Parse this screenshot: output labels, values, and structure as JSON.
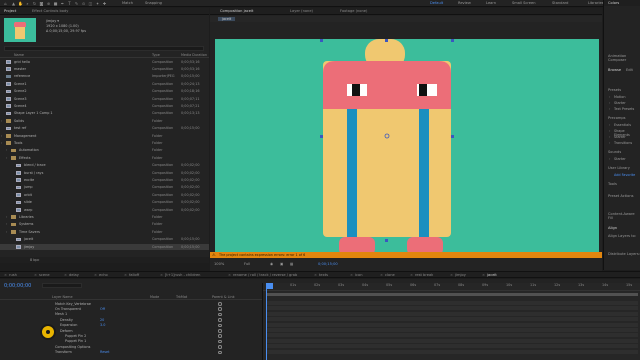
{
  "toolbar": {
    "tools": [
      "home",
      "select",
      "hand",
      "zoom",
      "rotate",
      "camera",
      "pan",
      "mask",
      "pen",
      "type",
      "brush",
      "clone",
      "eraser",
      "roto",
      "puppet"
    ],
    "match_label": "Match",
    "snapping_label": "Snapping",
    "ws": {
      "default": "Default",
      "review": "Review",
      "learn": "Learn",
      "small_screen": "Small Screen",
      "standard": "Standard",
      "libraries": "Libraries"
    },
    "colors": {
      "accent": "#4a8ef0",
      "canvas_bg": "#3cbd9b",
      "warning": "#e2860e"
    }
  },
  "project": {
    "tabs": [
      "Project",
      "Effect Controls body"
    ],
    "selected_name": "jimjoy ▾",
    "info": [
      "1920 x 1080 (1.00)",
      "Δ 0;00;15;00, 29.97 fps"
    ],
    "columns": {
      "name": "Name",
      "type": "Type",
      "duration": "Media Duration"
    },
    "rows": [
      {
        "name": "grid hello",
        "type": "Composition",
        "duration": "0;00;53;16",
        "icon": "comp",
        "indent": 0
      },
      {
        "name": "master",
        "type": "Composition",
        "duration": "0;00;53;16",
        "icon": "comp",
        "indent": 0
      },
      {
        "name": "reference",
        "type": "ImporterJPEG",
        "duration": "0;00;15;00",
        "icon": "img",
        "indent": 0
      },
      {
        "name": "Scene1",
        "type": "Composition",
        "duration": "0;00;24;13",
        "icon": "comp",
        "indent": 0
      },
      {
        "name": "Scene2",
        "type": "Composition",
        "duration": "0;00;18;16",
        "icon": "comp",
        "indent": 0
      },
      {
        "name": "Scene3",
        "type": "Composition",
        "duration": "0;00;07;11",
        "icon": "comp",
        "indent": 0
      },
      {
        "name": "Scene4",
        "type": "Composition",
        "duration": "0;00;07;21",
        "icon": "comp",
        "indent": 0
      },
      {
        "name": "Shape Layer 1 Comp 1",
        "type": "Composition",
        "duration": "0;00;13;13",
        "icon": "comp",
        "indent": 0
      },
      {
        "name": "Solids",
        "type": "Folder",
        "duration": "",
        "icon": "folder",
        "indent": 0
      },
      {
        "name": "test ref",
        "type": "Composition",
        "duration": "0;00;15;00",
        "icon": "comp",
        "indent": 0
      },
      {
        "name": "Management",
        "type": "Folder",
        "duration": "",
        "icon": "folder",
        "indent": 0
      },
      {
        "name": "Tools",
        "type": "Folder",
        "duration": "",
        "icon": "folder",
        "indent": 0
      },
      {
        "name": "Automation",
        "type": "Folder",
        "duration": "",
        "icon": "folder",
        "indent": 1
      },
      {
        "name": "Effects",
        "type": "Folder",
        "duration": "",
        "icon": "folder",
        "indent": 1
      },
      {
        "name": "blend / trace",
        "type": "Composition",
        "duration": "0;00;02;00",
        "icon": "comp",
        "indent": 2
      },
      {
        "name": "burst / rays",
        "type": "Composition",
        "duration": "0;00;02;00",
        "icon": "comp",
        "indent": 2
      },
      {
        "name": "excite",
        "type": "Composition",
        "duration": "0;00;02;00",
        "icon": "comp",
        "indent": 2
      },
      {
        "name": "jump",
        "type": "Composition",
        "duration": "0;00;02;00",
        "icon": "comp",
        "indent": 2
      },
      {
        "name": "orbit",
        "type": "Composition",
        "duration": "0;00;02;00",
        "icon": "comp",
        "indent": 2
      },
      {
        "name": "slide",
        "type": "Composition",
        "duration": "0;00;02;00",
        "icon": "comp",
        "indent": 2
      },
      {
        "name": "warp",
        "type": "Composition",
        "duration": "0;00;02;00",
        "icon": "comp",
        "indent": 2
      },
      {
        "name": "Libraries",
        "type": "Folder",
        "duration": "",
        "icon": "folder",
        "indent": 1
      },
      {
        "name": "Systems",
        "type": "Folder",
        "duration": "",
        "icon": "folder",
        "indent": 1
      },
      {
        "name": "Time Savers",
        "type": "Folder",
        "duration": "",
        "icon": "folder",
        "indent": 1
      },
      {
        "name": "jaceit",
        "type": "Composition",
        "duration": "0;00;15;00",
        "icon": "comp",
        "indent": 2
      },
      {
        "name": "jimjoy",
        "type": "Composition",
        "duration": "0;00;15;00",
        "icon": "comp",
        "indent": 2,
        "selected": true
      }
    ],
    "footer_depth": "8 bpc"
  },
  "viewer": {
    "tabs": [
      "Composition jaceit",
      "Layer (none)",
      "Footage (none)"
    ],
    "breadcrumb": "jaceit",
    "warning": "The project contains expression errors: error 1 of 6",
    "zoom": "100%",
    "quality": "Full",
    "timecode": "0;00;15;00"
  },
  "right_panel": {
    "header": "Colors",
    "items_top": [
      "Animation Composer"
    ],
    "tabs": [
      "Browse",
      "Edit"
    ],
    "presets_label": "Presets",
    "preset_items": [
      "Motion",
      "Starter",
      "Text Presets"
    ],
    "precomps_label": "Precomps",
    "precomp_items": [
      "Essentials",
      "Shape Elements",
      "Starter",
      "Transitions"
    ],
    "sounds_label": "Sounds",
    "sounds_items": [
      "Starter"
    ],
    "user_library": "User Library",
    "user_items": [
      "Add Favorite"
    ],
    "tools_label": "Tools",
    "preset_actions": "Preset Actions",
    "content_aware_fill": "Content-Aware Fill",
    "align_label": "Align",
    "align_layers_to": "Align Layers to:",
    "distribute_layers": "Distribute Layers:"
  },
  "timeline_tabs": [
    {
      "label": "rush",
      "active": false
    },
    {
      "label": "scene",
      "active": false
    },
    {
      "label": "delay",
      "active": false
    },
    {
      "label": "echo",
      "active": false
    },
    {
      "label": "falloff",
      "active": false
    },
    {
      "label": "[t+1]rush - children",
      "active": false
    },
    {
      "label": "rename / roll / track / reverse / grab",
      "active": false
    },
    {
      "label": "texts",
      "active": false
    },
    {
      "label": "icon",
      "active": false
    },
    {
      "label": "clone",
      "active": false
    },
    {
      "label": "rest break",
      "active": false
    },
    {
      "label": "jimjoy",
      "active": false
    },
    {
      "label": "jaceit",
      "active": true
    }
  ],
  "timeline": {
    "timecode": "0;00;00;00",
    "columns": {
      "name": "Layer Name",
      "mode": "Mode",
      "trkmat": "TrkMat",
      "parent": "Parent & Link"
    },
    "layers": [
      {
        "name": "Match Key_Vertebrae",
        "value": "",
        "indent": 1
      },
      {
        "name": "On Transparent",
        "value": "Off",
        "indent": 1
      },
      {
        "name": "Mesh 1",
        "value": "",
        "indent": 1
      },
      {
        "name": "Density",
        "value": "20",
        "indent": 2
      },
      {
        "name": "Expansion",
        "value": "3.0",
        "indent": 2
      },
      {
        "name": "Deform",
        "value": "",
        "indent": 2
      },
      {
        "name": "Puppet Pin 2",
        "value": "",
        "indent": 3
      },
      {
        "name": "Puppet Pin 1",
        "value": "",
        "indent": 3
      },
      {
        "name": "Compositing Options",
        "value": "",
        "indent": 1
      },
      {
        "name": "Transform",
        "value": "Reset",
        "indent": 1
      }
    ],
    "ruler": [
      "0s",
      "01s",
      "02s",
      "03s",
      "04s",
      "05s",
      "06s",
      "07s",
      "08s",
      "09s",
      "10s",
      "11s",
      "12s",
      "13s",
      "14s",
      "15s"
    ]
  }
}
